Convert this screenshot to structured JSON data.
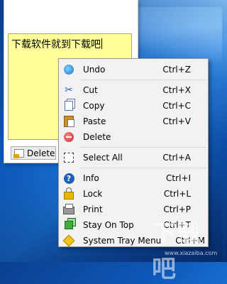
{
  "note": {
    "text": "下载软件就到下载吧",
    "delete_label": "Delete"
  },
  "menu": {
    "items": [
      {
        "label": "Undo",
        "shortcut": "Ctrl+Z",
        "icon": "undo-icon"
      },
      {
        "label": "Cut",
        "shortcut": "Ctrl+X",
        "icon": "cut-icon"
      },
      {
        "label": "Copy",
        "shortcut": "Ctrl+C",
        "icon": "copy-icon"
      },
      {
        "label": "Paste",
        "shortcut": "Ctrl+V",
        "icon": "paste-icon"
      },
      {
        "label": "Delete",
        "shortcut": "",
        "icon": "delete-icon"
      },
      {
        "label": "Select All",
        "shortcut": "Ctrl+A",
        "icon": "select-all-icon"
      },
      {
        "label": "Info",
        "shortcut": "Ctrl+I",
        "icon": "info-icon"
      },
      {
        "label": "Lock",
        "shortcut": "Ctrl+L",
        "icon": "lock-icon"
      },
      {
        "label": "Print",
        "shortcut": "Ctrl+P",
        "icon": "print-icon"
      },
      {
        "label": "Stay On Top",
        "shortcut": "Ctrl+T",
        "icon": "stay-on-top-icon"
      },
      {
        "label": "System Tray Menu",
        "shortcut": "Ctrl+M",
        "icon": "tray-icon"
      }
    ]
  },
  "watermark": {
    "text": "下载吧",
    "url": "www.xiazaiba.com"
  },
  "colors": {
    "note_bg": "#ffff99",
    "desktop": "#0e58b8"
  }
}
